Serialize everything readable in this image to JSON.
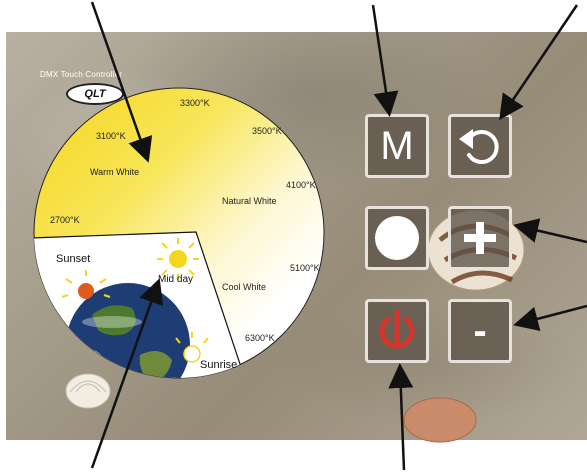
{
  "app": {
    "title": "DMX Touch Controller",
    "logo_text": "QLT"
  },
  "wheel": {
    "temps": [
      "3300°K",
      "3500°K",
      "3100°K",
      "4100°K",
      "2700°K",
      "5100°K",
      "6300°K"
    ],
    "zones": {
      "warm": "Warm White",
      "natural": "Natural White",
      "cool": "Cool White"
    }
  },
  "daycycle": {
    "sunset": "Sunset",
    "midday": "Mid day",
    "sunrise": "Sunrise"
  },
  "buttons": {
    "mode_label": "M",
    "minus_label": "-"
  },
  "colors": {
    "warm_yellow": "#f7df2e",
    "button_fill": "#5c5248",
    "button_border": "#e6e2dc",
    "power_red": "#d9342b",
    "sun_yellow": "#f3d71e",
    "sunset_orange": "#e05a1e"
  }
}
